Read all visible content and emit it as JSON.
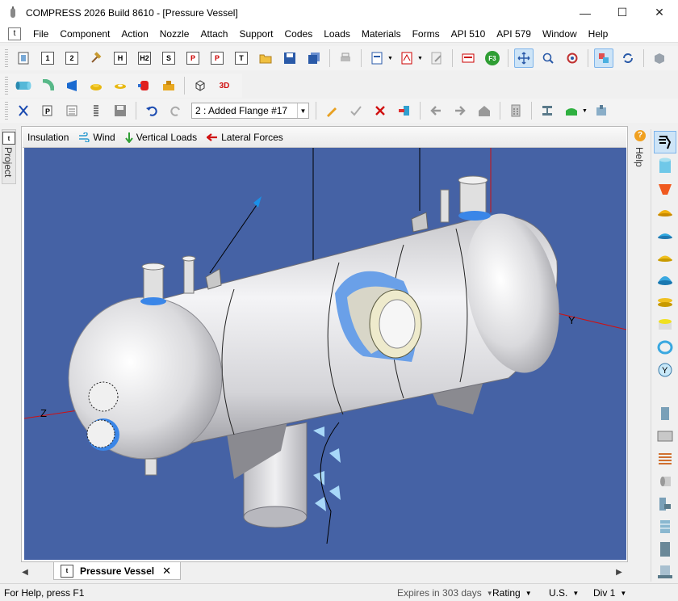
{
  "window": {
    "title": "COMPRESS 2026 Build 8610 - [Pressure Vessel]",
    "controls": {
      "minimize": "—",
      "maximize": "☐",
      "close": "✕"
    }
  },
  "menu": {
    "doc_icon": "t",
    "items": [
      "File",
      "Component",
      "Action",
      "Nozzle",
      "Attach",
      "Support",
      "Codes",
      "Loads",
      "Materials",
      "Forms",
      "API 510",
      "API 579",
      "Window",
      "Help"
    ]
  },
  "toolbar3": {
    "component_select": "2 : Added Flange #17"
  },
  "toolbar1": {
    "sheet_labels": [
      "1",
      "2",
      "H",
      "H2",
      "S",
      "P",
      "P",
      "T"
    ],
    "f3_label": "F3"
  },
  "toolbar2": {
    "label_3d": "3D"
  },
  "project_tab": {
    "label": "Project"
  },
  "help_tab": {
    "label": "Help",
    "glyph": "?"
  },
  "viewport_toolbar": {
    "items": [
      {
        "label": "Insulation",
        "icon": "none"
      },
      {
        "label": "Wind",
        "icon": "wind-icon"
      },
      {
        "label": "Vertical Loads",
        "icon": "down-arrow-icon"
      },
      {
        "label": "Lateral Forces",
        "icon": "left-arrow-icon"
      }
    ]
  },
  "scene": {
    "background": "#4562a5",
    "axis_labels": {
      "y": "Y",
      "z": "Z"
    }
  },
  "doc_tabs": {
    "nav_left": "◀",
    "nav_right": "▶",
    "active": "Pressure Vessel",
    "close": "✕"
  },
  "status": {
    "help": "For Help, press F1",
    "expires": "Expires in 303 days",
    "rating": "Rating",
    "units": "U.S.",
    "division": "Div 1"
  }
}
